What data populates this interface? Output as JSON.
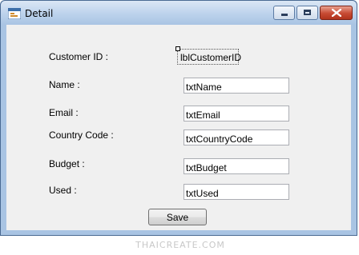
{
  "window": {
    "title": "Detail"
  },
  "icons": {
    "app": "form-window-icon",
    "minimize": "minimize-icon",
    "maximize": "maximize-icon",
    "close": "close-icon"
  },
  "colors": {
    "titlebar": "#bcd2ec",
    "client": "#f0f0f0",
    "close": "#c74a33"
  },
  "form": {
    "customer_id_label": "Customer ID :",
    "customer_id_value": "lblCustomerID",
    "name_label": "Name :",
    "name_value": "txtName",
    "email_label": "Email :",
    "email_value": "txtEmail",
    "country_label": "Country Code :",
    "country_value": "txtCountryCode",
    "budget_label": "Budget :",
    "budget_value": "txtBudget",
    "used_label": "Used :",
    "used_value": "txtUsed",
    "save_label": "Save"
  },
  "watermark": "THAICREATE.COM"
}
